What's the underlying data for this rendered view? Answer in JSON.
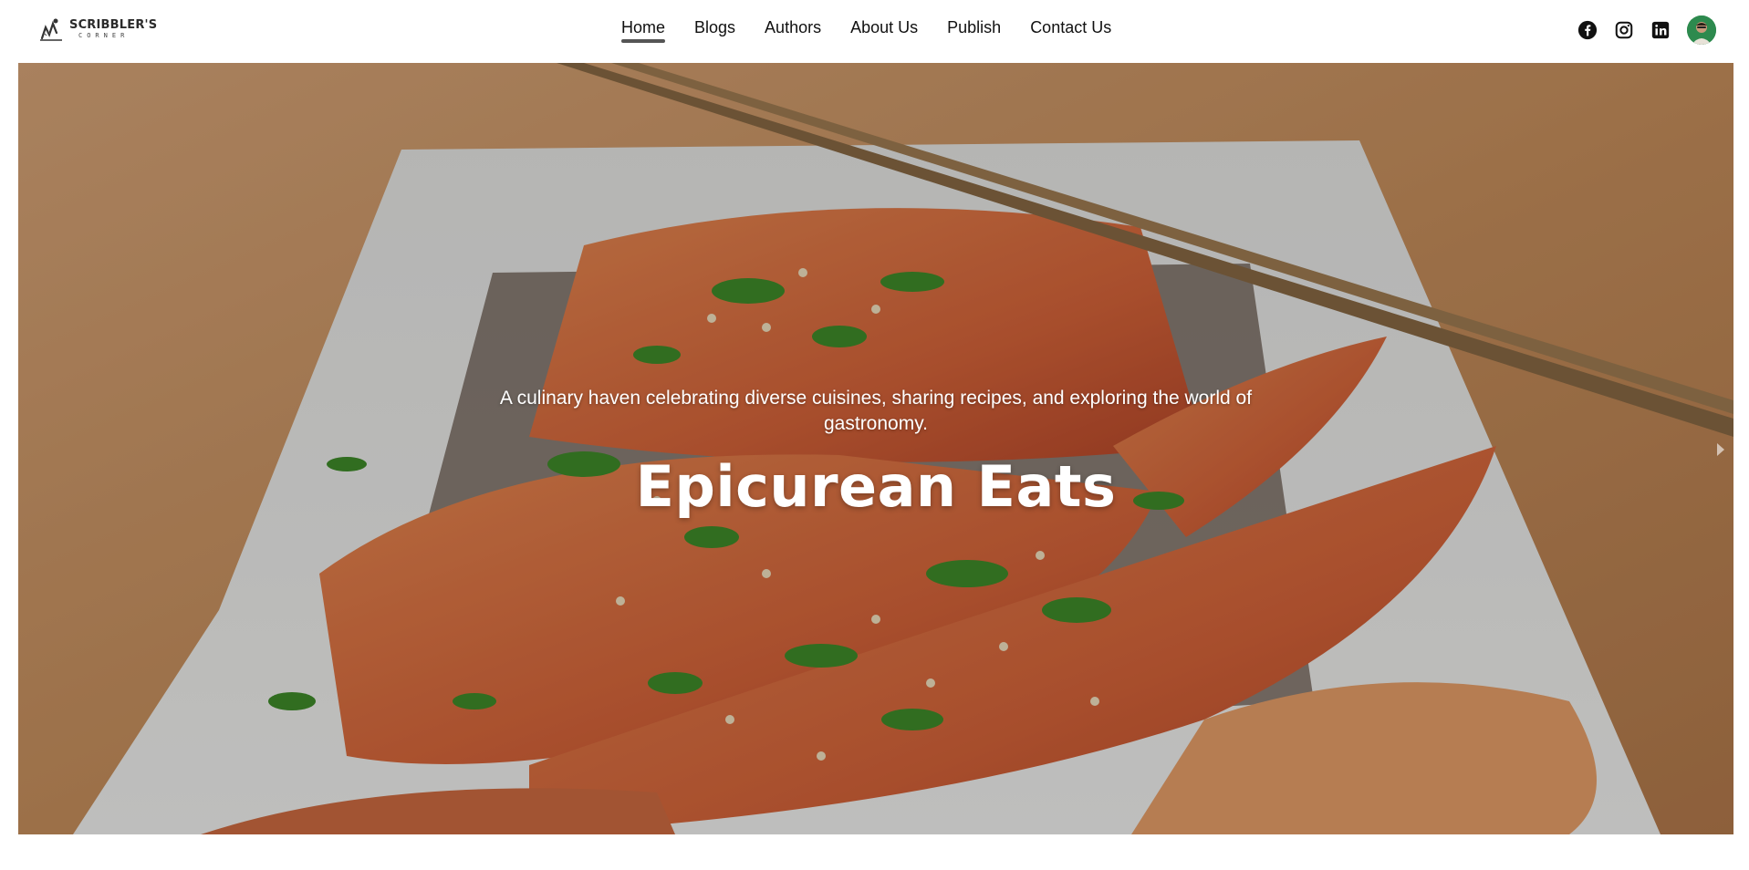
{
  "brand": {
    "name": "SCRIBBLER'S",
    "subname": "CORNER"
  },
  "nav": {
    "items": [
      {
        "label": "Home",
        "active": true
      },
      {
        "label": "Blogs",
        "active": false
      },
      {
        "label": "Authors",
        "active": false
      },
      {
        "label": "About Us",
        "active": false
      },
      {
        "label": "Publish",
        "active": false
      },
      {
        "label": "Contact Us",
        "active": false
      }
    ]
  },
  "social": {
    "icons": [
      "facebook-icon",
      "instagram-icon",
      "linkedin-icon"
    ],
    "avatar": "user-avatar"
  },
  "hero": {
    "tagline": "A culinary haven celebrating diverse cuisines, sharing recipes, and exploring the world of gastronomy.",
    "title": "Epicurean Eats",
    "next_icon": "chevron-right-icon"
  },
  "colors": {
    "nav_underline": "#555555",
    "overlay": "rgba(0,0,0,0.22)",
    "avatar_bg": "#2d8a4e"
  }
}
